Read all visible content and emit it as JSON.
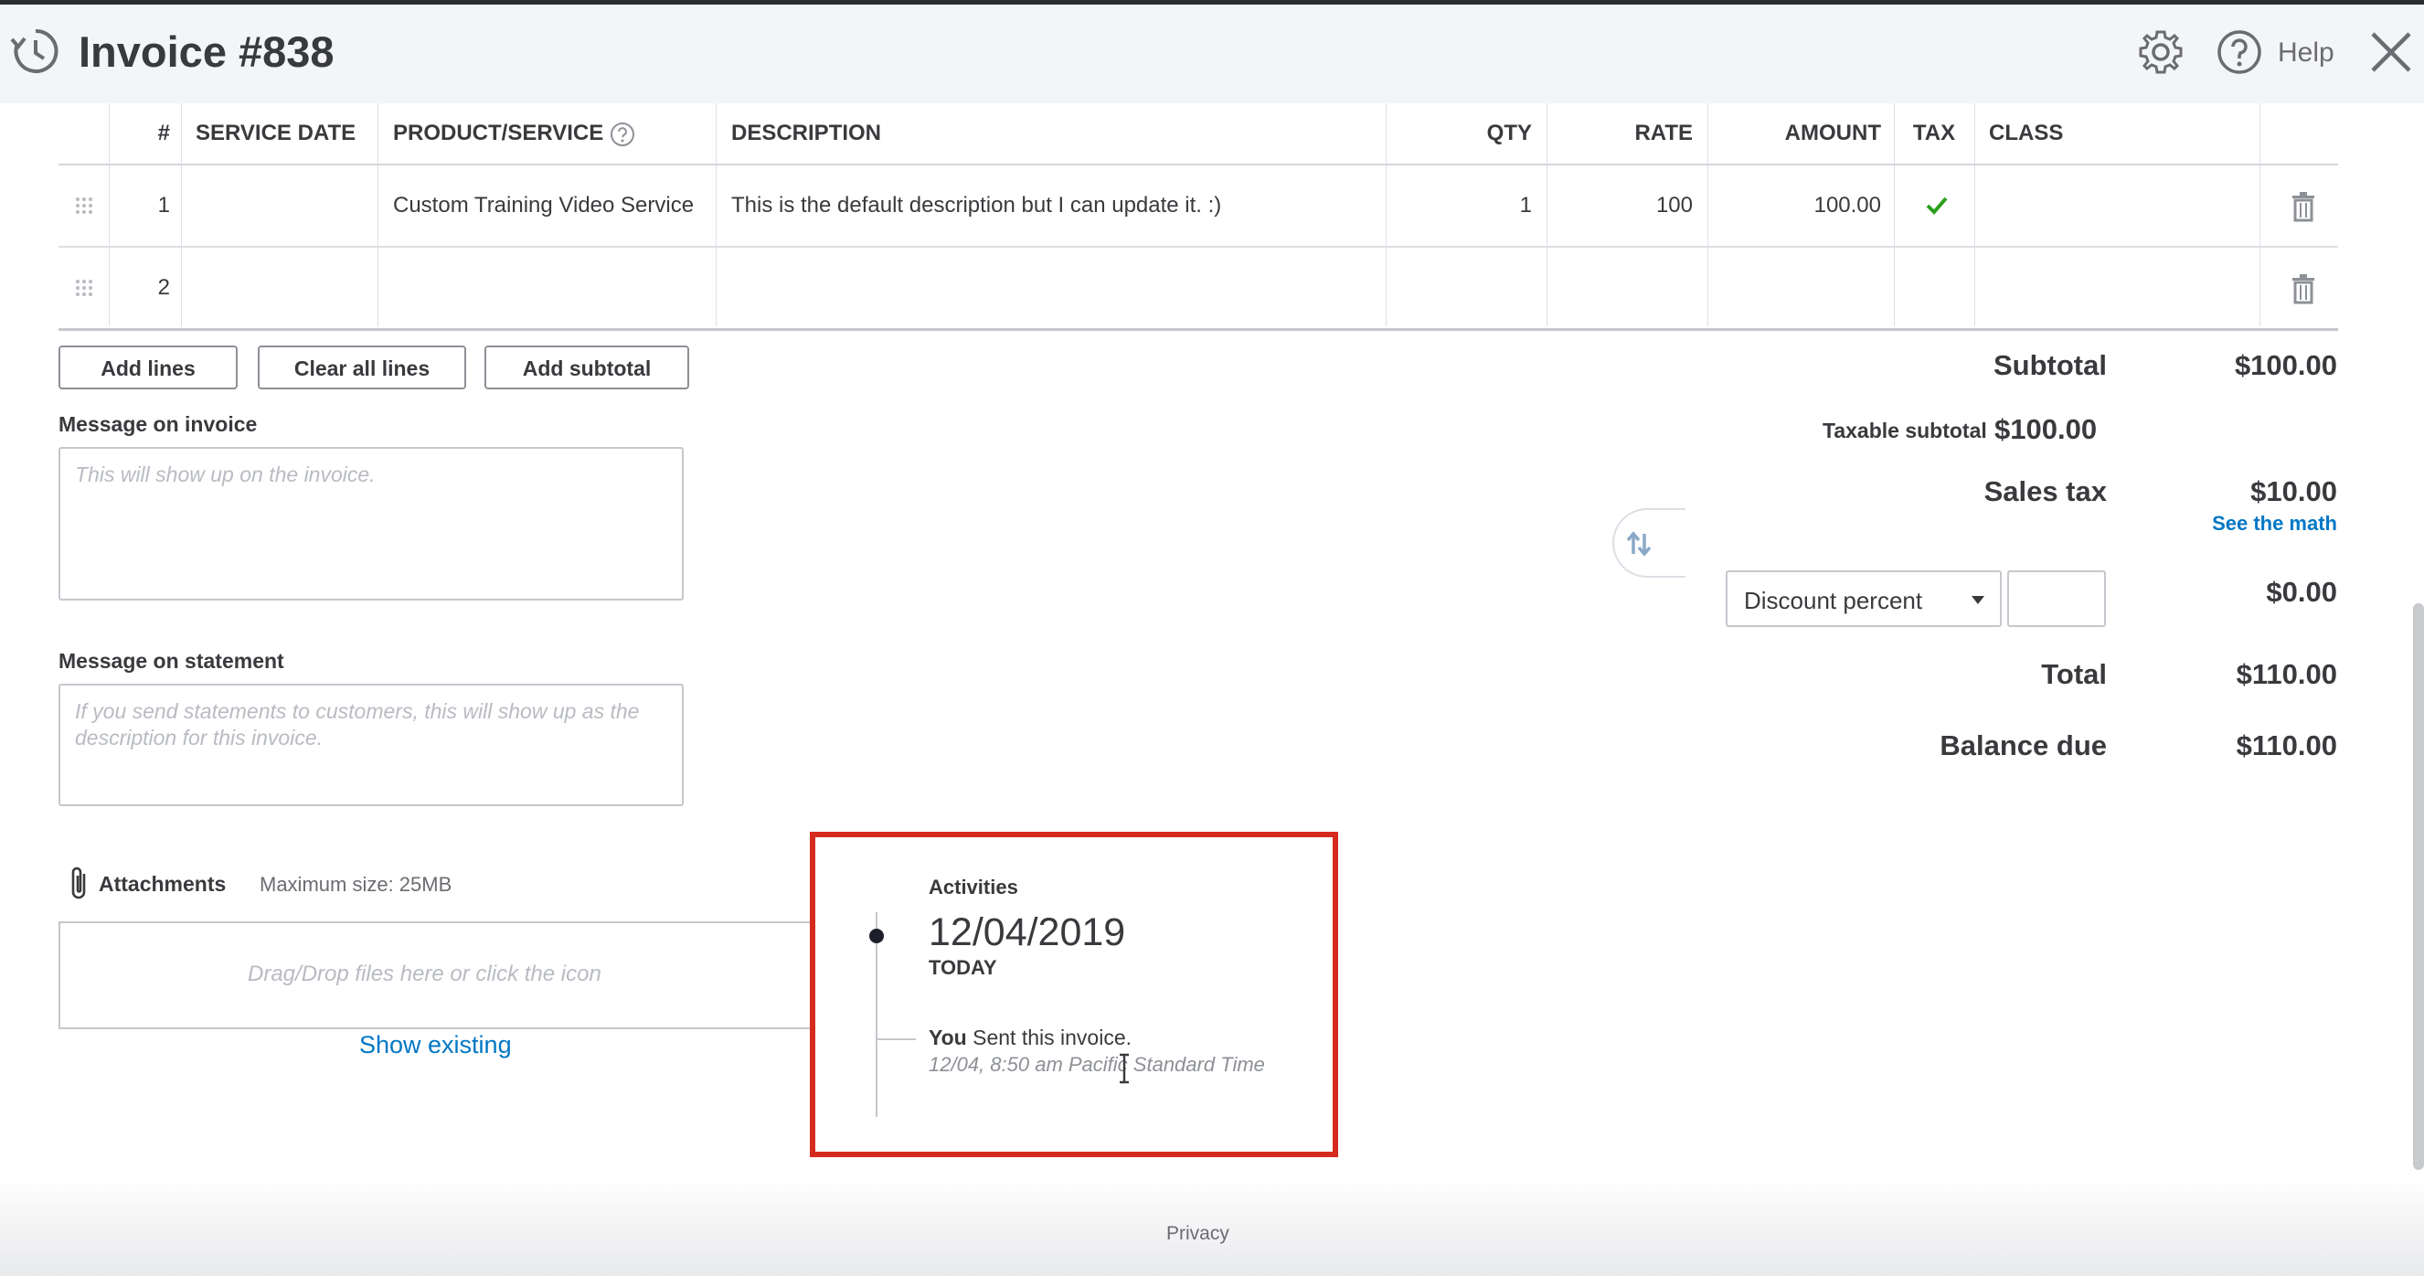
{
  "header": {
    "title": "Invoice #838",
    "help_label": "Help"
  },
  "table": {
    "columns": [
      "#",
      "SERVICE DATE",
      "PRODUCT/SERVICE",
      "DESCRIPTION",
      "QTY",
      "RATE",
      "AMOUNT",
      "TAX",
      "CLASS"
    ],
    "rows": [
      {
        "num": "1",
        "service_date": "",
        "product": "Custom Training Video Service",
        "description": "This is the default description but I can update it. :)",
        "qty": "1",
        "rate": "100",
        "amount": "100.00",
        "tax": true,
        "class": ""
      },
      {
        "num": "2",
        "service_date": "",
        "product": "",
        "description": "",
        "qty": "",
        "rate": "",
        "amount": "",
        "tax": false,
        "class": ""
      }
    ]
  },
  "buttons": {
    "add_lines": "Add lines",
    "clear_all_lines": "Clear all lines",
    "add_subtotal": "Add subtotal"
  },
  "message_invoice": {
    "label": "Message on invoice",
    "placeholder": "This will show up on the invoice."
  },
  "message_statement": {
    "label": "Message on statement",
    "placeholder": "If you send statements to customers, this will show up as the description for this invoice."
  },
  "totals": {
    "subtotal_label": "Subtotal",
    "subtotal_value": "$100.00",
    "taxable_label": "Taxable subtotal",
    "taxable_value": "$100.00",
    "sales_tax_label": "Sales tax",
    "sales_tax_value": "$10.00",
    "see_math": "See the math",
    "discount_select": "Discount percent",
    "discount_value": "$0.00",
    "total_label": "Total",
    "total_value": "$110.00",
    "balance_label": "Balance due",
    "balance_value": "$110.00"
  },
  "attachments": {
    "label": "Attachments",
    "max_size": "Maximum size: 25MB",
    "dropzone": "Drag/Drop files here or click the icon",
    "show_existing": "Show existing"
  },
  "activities": {
    "title": "Activities",
    "date": "12/04/2019",
    "today": "TODAY",
    "actor": "You",
    "action": " Sent this invoice.",
    "time": "12/04, 8:50 am Pacific Standard Time"
  },
  "footer": {
    "privacy": "Privacy"
  },
  "colors": {
    "accent_blue": "#0077c5",
    "check_green": "#2ca01c",
    "highlight_red": "#d52b1e"
  }
}
